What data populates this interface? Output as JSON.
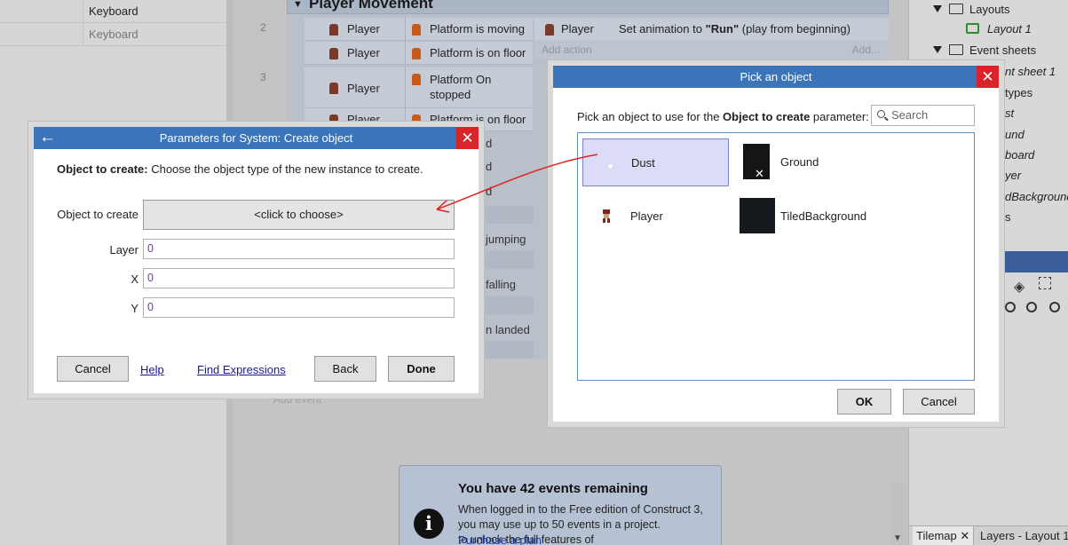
{
  "left_panel": {
    "rows": [
      "Keyboard",
      "Keyboard"
    ]
  },
  "event_sheet": {
    "group_title": "Player Movement",
    "events": [
      {
        "number": "2",
        "conditions": [
          {
            "object": "Player",
            "text": "Platform is moving"
          },
          {
            "object": "Player",
            "text": "Platform is on floor"
          }
        ],
        "action": {
          "object": "Player",
          "prefix": "Set animation to ",
          "bold": "\"Run\"",
          "suffix": " (play from beginning)"
        }
      },
      {
        "number": "3",
        "conditions": [
          {
            "object": "Player",
            "text": "Platform On stopped"
          },
          {
            "object": "Player",
            "text": "Platform is on floor"
          }
        ]
      }
    ],
    "add_action": "Add action",
    "add_action_right": "Add...",
    "partial_texts": [
      "d",
      "d",
      "d",
      "jumping",
      "falling",
      "n landed"
    ],
    "add_event": "Add event"
  },
  "notice": {
    "title": "You have 42 events remaining",
    "body": "When logged in to the Free edition of Construct 3, you may use up to 50 events in a project.",
    "link": "Purchase a plan",
    "link_suffix": " to unlock the full features of"
  },
  "project_tree": {
    "layouts_folder": "Layouts",
    "layout_1": "Layout 1",
    "event_sheets_folder": "Event sheets",
    "event_sheet_1": "nt sheet 1",
    "partials": [
      "types",
      "st",
      "und",
      "board",
      "yer",
      "dBackground",
      "s"
    ]
  },
  "bottom_tabs": {
    "tilemap": "Tilemap",
    "layers": "Layers - Layout 1"
  },
  "params_dialog": {
    "title": "Parameters for System: Create object",
    "desc_bold": "Object to create:",
    "desc": " Choose the object type of the new instance to create.",
    "fields": {
      "object_label": "Object to create",
      "object_value": "<click to choose>",
      "layer_label": "Layer",
      "layer_value": "0",
      "x_label": "X",
      "x_value": "0",
      "y_label": "Y",
      "y_value": "0"
    },
    "buttons": {
      "cancel": "Cancel",
      "help": "Help",
      "find": "Find Expressions",
      "back": "Back",
      "done": "Done"
    }
  },
  "pick_dialog": {
    "title": "Pick an object",
    "prompt_pre": "Pick an object to use for the ",
    "prompt_bold": "Object to create",
    "prompt_post": " parameter:",
    "search_placeholder": "Search",
    "objects": [
      "Dust",
      "Ground",
      "Player",
      "TiledBackground"
    ],
    "selected": "Dust",
    "buttons": {
      "ok": "OK",
      "cancel": "Cancel"
    }
  },
  "colors": {
    "title_bar": "#3b74b8",
    "close": "#d9252a",
    "annotation_arrow": "#e02020",
    "selection": "#dcdcf8"
  }
}
